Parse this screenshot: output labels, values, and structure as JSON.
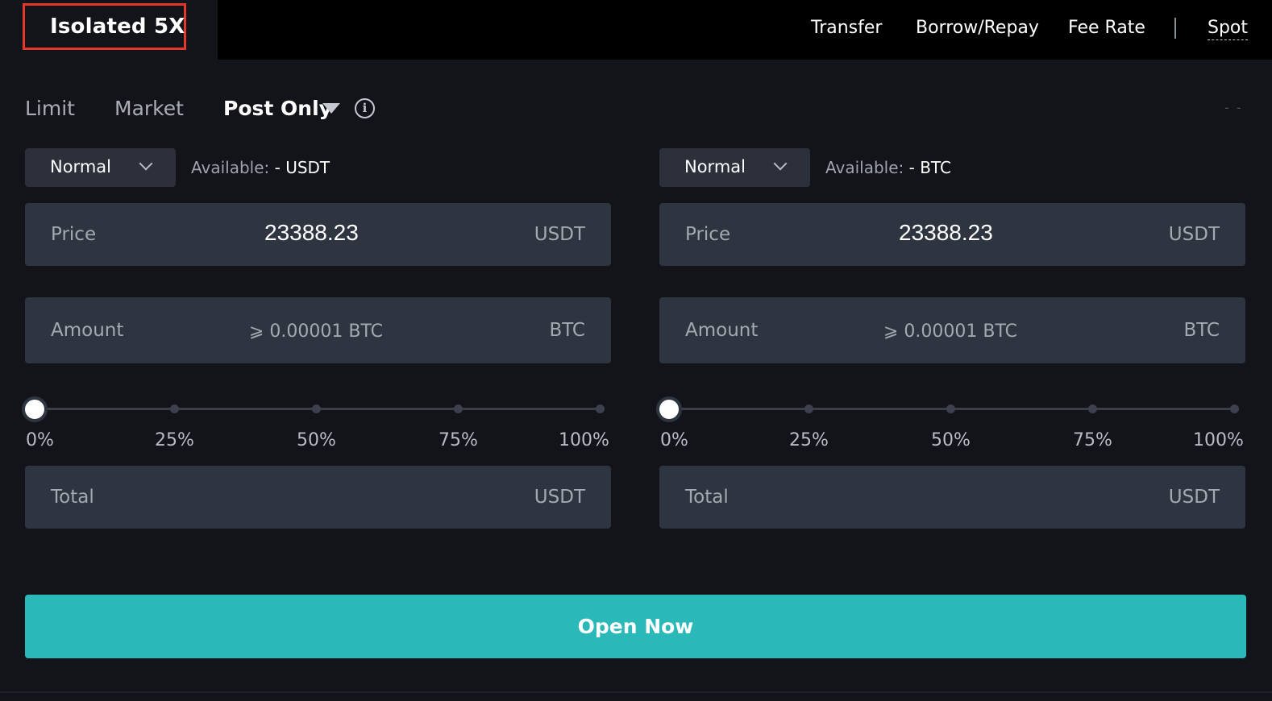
{
  "header": {
    "mode_label": "Isolated 5X",
    "links": {
      "transfer": "Transfer",
      "borrow_repay": "Borrow/Repay",
      "fee_rate": "Fee Rate",
      "spot": "Spot"
    }
  },
  "order_types": {
    "limit": "Limit",
    "market": "Market",
    "post_only": "Post Only"
  },
  "right_indicator": "- -",
  "panels": {
    "buy": {
      "select_label": "Normal",
      "available_key": "Available:",
      "available_value": "- USDT",
      "price_label": "Price",
      "price_value": "23388.23",
      "price_unit": "USDT",
      "amount_label": "Amount",
      "amount_placeholder": "⩾ 0.00001 BTC",
      "amount_unit": "BTC",
      "slider_value_percent": 0,
      "slider_labels": [
        "0%",
        "25%",
        "50%",
        "75%",
        "100%"
      ],
      "total_label": "Total",
      "total_unit": "USDT"
    },
    "sell": {
      "select_label": "Normal",
      "available_key": "Available:",
      "available_value": "- BTC",
      "price_label": "Price",
      "price_value": "23388.23",
      "price_unit": "USDT",
      "amount_label": "Amount",
      "amount_placeholder": "⩾ 0.00001 BTC",
      "amount_unit": "BTC",
      "slider_value_percent": 0,
      "slider_labels": [
        "0%",
        "25%",
        "50%",
        "75%",
        "100%"
      ],
      "total_label": "Total",
      "total_unit": "USDT"
    }
  },
  "action_button": "Open Now",
  "colors": {
    "accent": "#2bb8b8",
    "highlight_box": "#e3382b",
    "background": "#12141a",
    "field": "#2f3441"
  }
}
